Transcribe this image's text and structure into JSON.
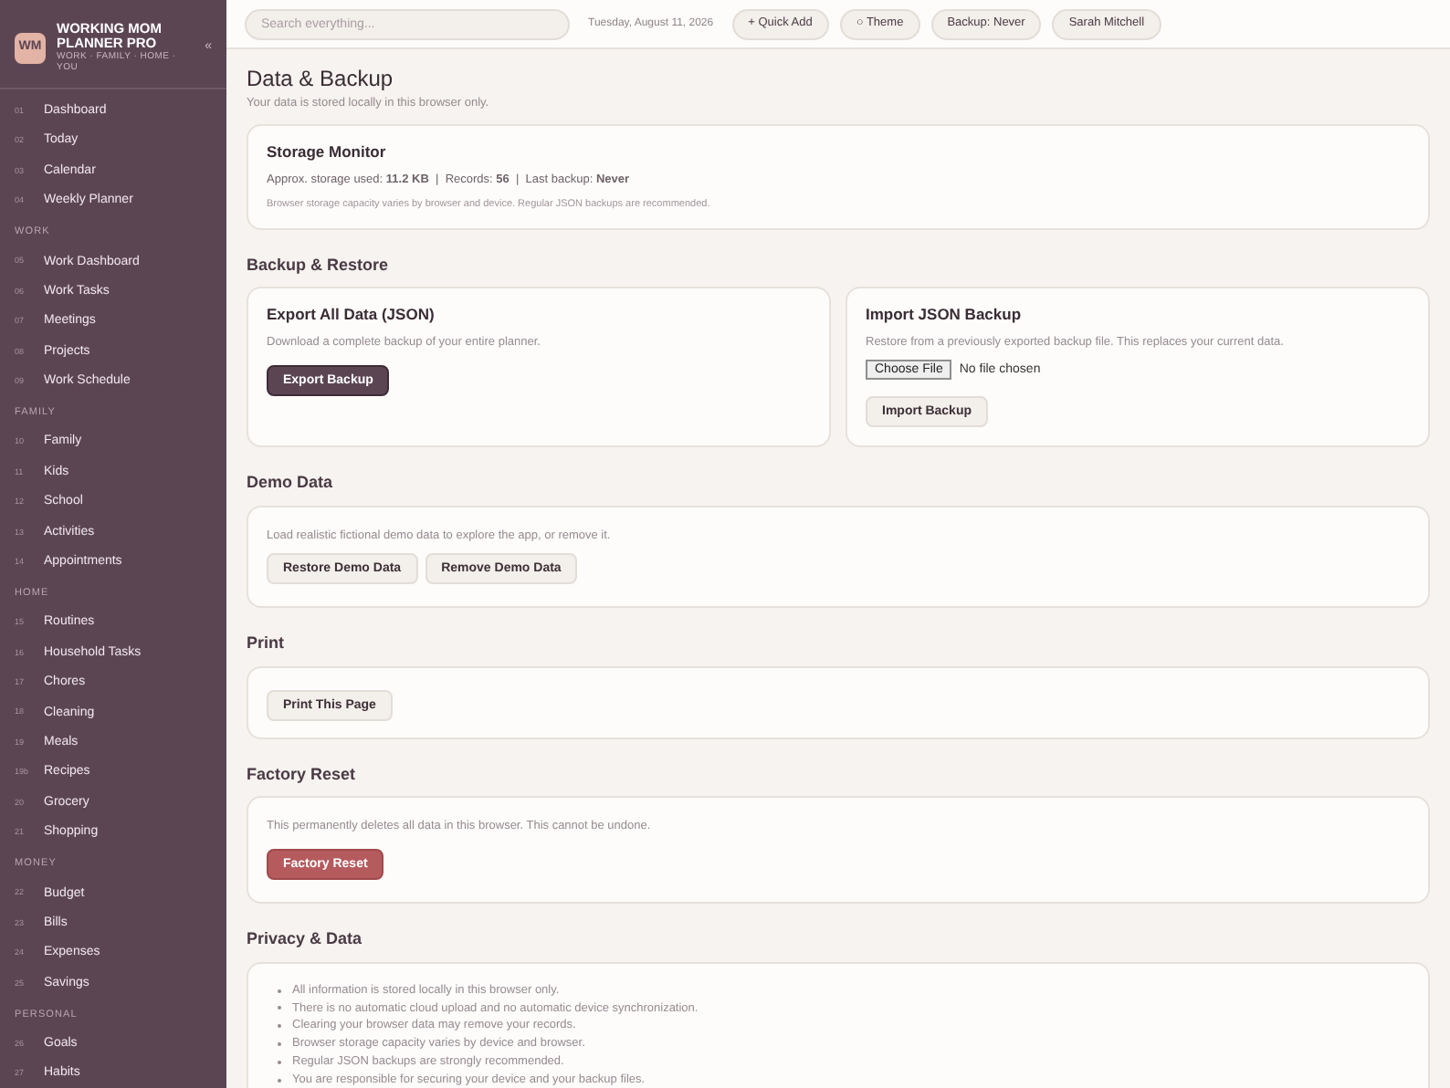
{
  "brand": {
    "logo": "WM",
    "name": "WORKING MOM PLANNER PRO",
    "tagline": "WORK · FAMILY · HOME · YOU",
    "collapse": "«"
  },
  "sidebar": {
    "sections": [
      {
        "items": [
          {
            "number": "01",
            "label": "Dashboard",
            "selected": false
          },
          {
            "number": "02",
            "label": "Today",
            "selected": false
          },
          {
            "number": "03",
            "label": "Calendar",
            "selected": false
          },
          {
            "number": "04",
            "label": "Weekly Planner",
            "selected": false
          }
        ]
      },
      {
        "heading": "WORK",
        "items": [
          {
            "number": "05",
            "label": "Work Dashboard",
            "selected": false
          },
          {
            "number": "06",
            "label": "Work Tasks",
            "selected": false
          },
          {
            "number": "07",
            "label": "Meetings",
            "selected": false
          },
          {
            "number": "08",
            "label": "Projects",
            "selected": false
          },
          {
            "number": "09",
            "label": "Work Schedule",
            "selected": false
          }
        ]
      },
      {
        "heading": "FAMILY",
        "items": [
          {
            "number": "10",
            "label": "Family",
            "selected": false
          },
          {
            "number": "11",
            "label": "Kids",
            "selected": false
          },
          {
            "number": "12",
            "label": "School",
            "selected": false
          },
          {
            "number": "13",
            "label": "Activities",
            "selected": false
          },
          {
            "number": "14",
            "label": "Appointments",
            "selected": false
          }
        ]
      },
      {
        "heading": "HOME",
        "items": [
          {
            "number": "15",
            "label": "Routines",
            "selected": false
          },
          {
            "number": "16",
            "label": "Household Tasks",
            "selected": false
          },
          {
            "number": "17",
            "label": "Chores",
            "selected": false
          },
          {
            "number": "18",
            "label": "Cleaning",
            "selected": false
          },
          {
            "number": "19",
            "label": "Meals",
            "selected": false
          },
          {
            "number": "19b",
            "label": "Recipes",
            "selected": false
          },
          {
            "number": "20",
            "label": "Grocery",
            "selected": false
          },
          {
            "number": "21",
            "label": "Shopping",
            "selected": false
          }
        ]
      },
      {
        "heading": "MONEY",
        "items": [
          {
            "number": "22",
            "label": "Budget",
            "selected": false
          },
          {
            "number": "23",
            "label": "Bills",
            "selected": false
          },
          {
            "number": "24",
            "label": "Expenses",
            "selected": false
          },
          {
            "number": "25",
            "label": "Savings",
            "selected": false
          }
        ]
      },
      {
        "heading": "PERSONAL",
        "items": [
          {
            "number": "26",
            "label": "Goals",
            "selected": false
          },
          {
            "number": "27",
            "label": "Habits",
            "selected": false
          }
        ]
      }
    ]
  },
  "topbar": {
    "search_placeholder": "Search everything...",
    "date": "Tuesday, August 11, 2026",
    "buttons": [
      "+ Quick Add",
      "○ Theme",
      "Backup: Never",
      "Sarah Mitchell"
    ]
  },
  "page": {
    "title": "Data & Backup",
    "subtitle": "Your data is stored locally in this browser only."
  },
  "storage": {
    "title": "Storage Monitor",
    "stats": "Approx. storage used: **11.2 KB**  |  Records: **56**  |  Last backup: **Never**",
    "note": "Browser storage capacity varies by browser and device. Regular JSON backups are recommended."
  },
  "backup": {
    "heading": "Backup & Restore",
    "export": {
      "title": "Export All Data (JSON)",
      "text": "Download a complete backup of your entire planner.",
      "button": "Export Backup"
    },
    "import": {
      "title": "Import JSON Backup",
      "text": "Restore from a previously exported backup file. This replaces your current data.",
      "file_button": "Choose File",
      "file_status": "No file chosen",
      "button": "Import Backup"
    }
  },
  "demo": {
    "heading": "Demo Data",
    "text": "Load realistic fictional demo data to explore the app, or remove it.",
    "buttons": [
      "Restore Demo Data",
      "Remove Demo Data"
    ]
  },
  "print": {
    "heading": "Print",
    "button": "Print This Page"
  },
  "reset": {
    "heading": "Factory Reset",
    "text": "This permanently deletes all data in this browser. This cannot be undone.",
    "button": "Factory Reset"
  },
  "privacy": {
    "heading": "Privacy & Data",
    "items": [
      "All information is stored locally in this browser only.",
      "There is no automatic cloud upload and no automatic device synchronization.",
      "Clearing your browser data may remove your records.",
      "Browser storage capacity varies by device and browser.",
      "Regular JSON backups are strongly recommended.",
      "You are responsible for securing your device and your backup files."
    ]
  }
}
